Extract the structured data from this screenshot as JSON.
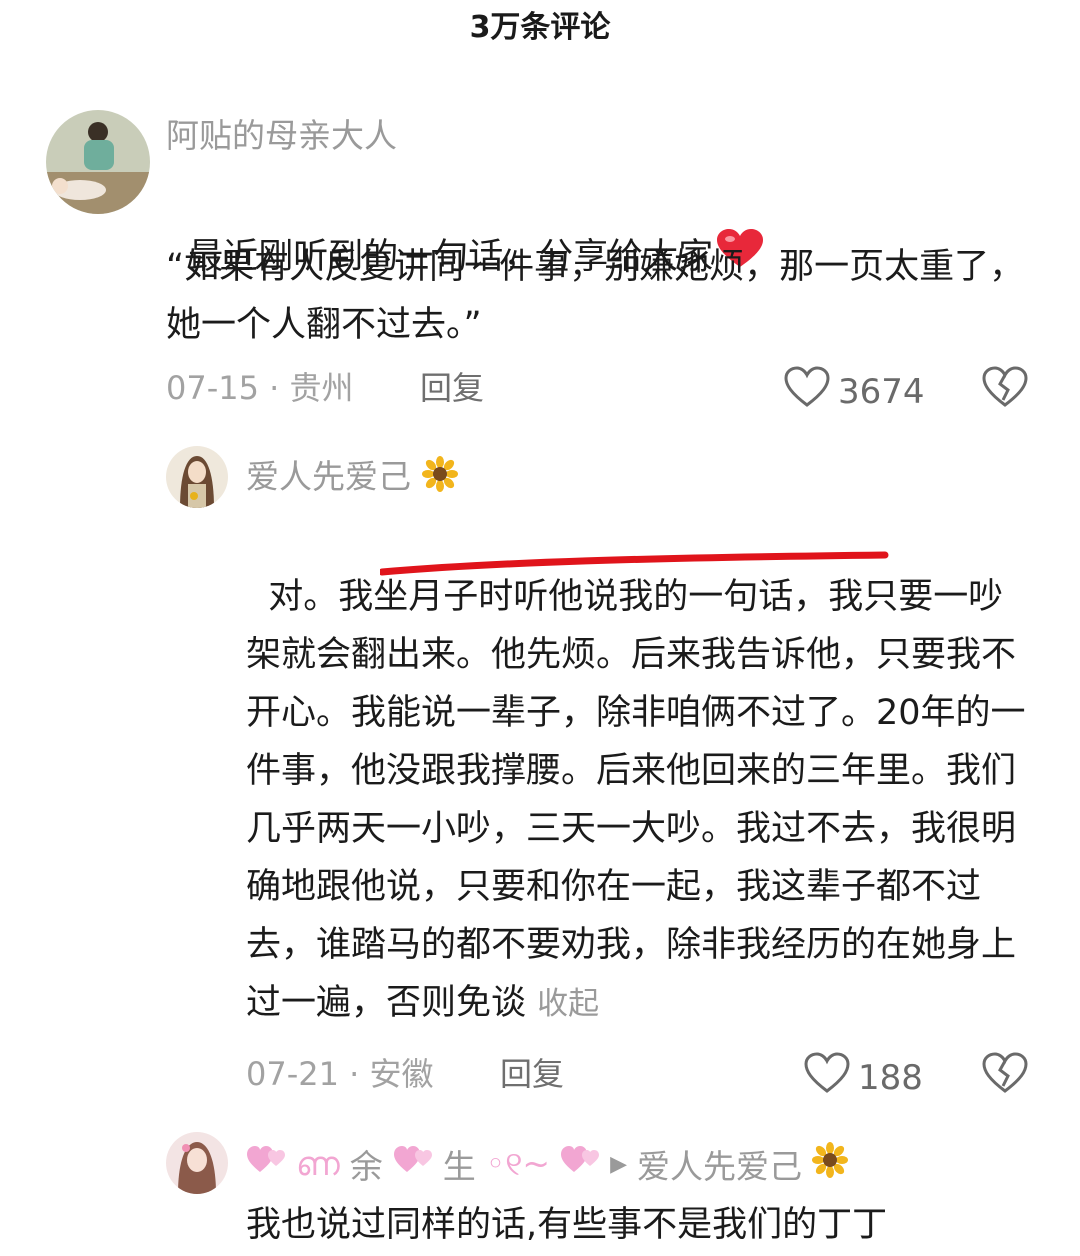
{
  "header": {
    "title": "3万条评论"
  },
  "comment1": {
    "username": "阿贴的母亲大人",
    "text_line1": "最近刚听到的一句话，分享给大家",
    "quote": "“如果有人反复讲同一件事，别嫌她烦，那一页太重了，她一个人翻不过去。”",
    "date": "07-15",
    "location": "贵州",
    "reply_label": "回复",
    "likes": "3674"
  },
  "reply1": {
    "username": "爱人先爱己",
    "text": "对。我坐月子时听他说我的一句话，我只要一吵架就会翻出来。他先烦。后来我告诉他，只要我不开心。我能说一辈子，除非咱俩不过了。20年的一件事，他没跟我撑腰。后来他回来的三年里。我们几乎两天一小吵，三天一大吵。我过不去，我很明确地跟他说，只要和你在一起，我这辈子都不过去，谁踏马的都不要劝我，除非我经历的在她身上过一遍，否则免谈",
    "collapse_label": "收起",
    "date": "07-21",
    "location": "安徽",
    "reply_label": "回复",
    "likes": "188"
  },
  "reply2": {
    "username_a": "余",
    "username_b": "生",
    "replied_to": "爱人先爱己",
    "text": "我也说过同样的话,有些事不是我们的丁丁"
  },
  "colors": {
    "underline": "#e0141b",
    "heart": "#e8283a",
    "pink": "#f2a6d2"
  },
  "icons": [
    "heart-outline-icon",
    "broken-heart-icon",
    "sunflower-icon",
    "red-heart-emoji",
    "pink-hearts-icon",
    "reply-arrow-icon"
  ]
}
